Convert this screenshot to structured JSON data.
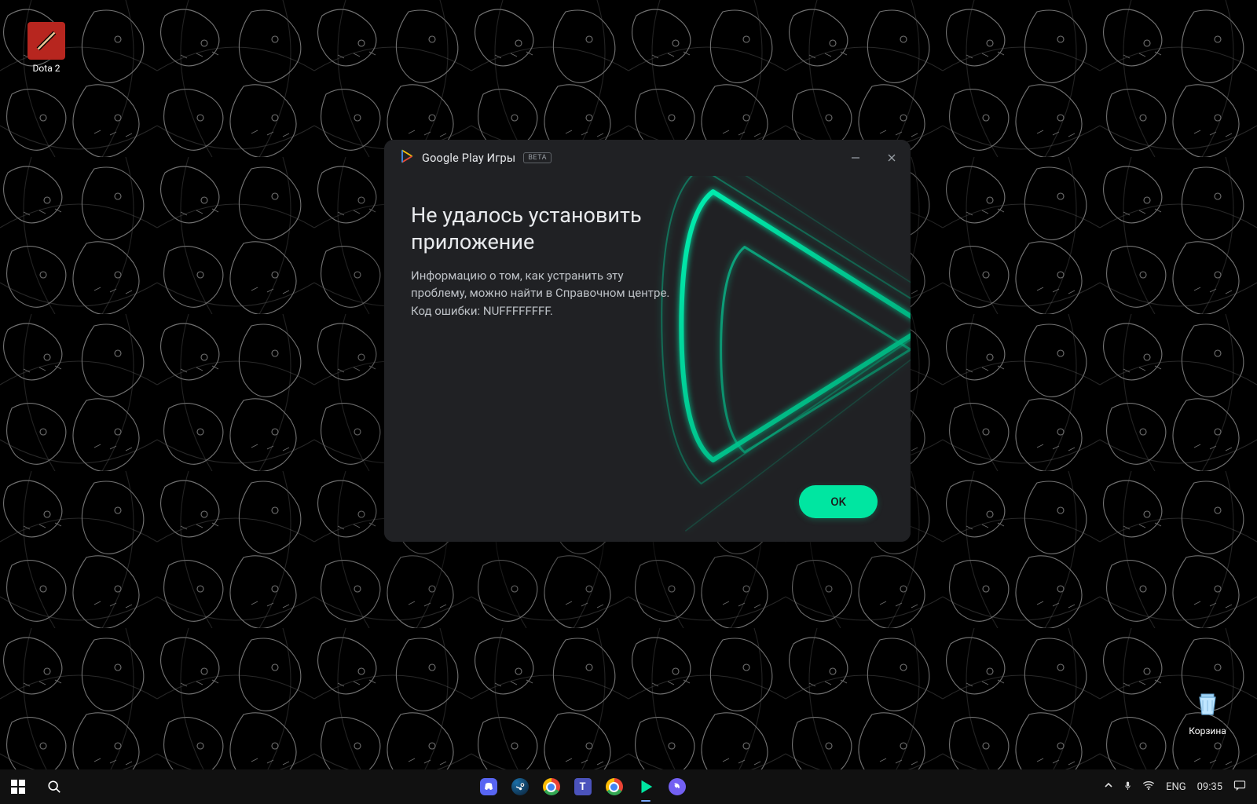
{
  "desktop_icons": {
    "dota2": {
      "label": "Dota 2"
    },
    "recycle": {
      "label": "Корзина"
    }
  },
  "dialog": {
    "app_title": "Google Play Игры",
    "beta_label": "BETA",
    "heading_l1": "Не удалось установить",
    "heading_l2": "приложение",
    "message_l1": "Информацию о том, как устранить эту",
    "message_l2": "проблему, можно найти в Справочном центре.",
    "message_l3": "Код ошибки: NUFFFFFFFF.",
    "ok_label": "OK"
  },
  "taskbar": {
    "input_language": "ENG",
    "clock": "09:35"
  },
  "colors": {
    "accent": "#00e6a1",
    "dialog_bg": "#202124"
  }
}
